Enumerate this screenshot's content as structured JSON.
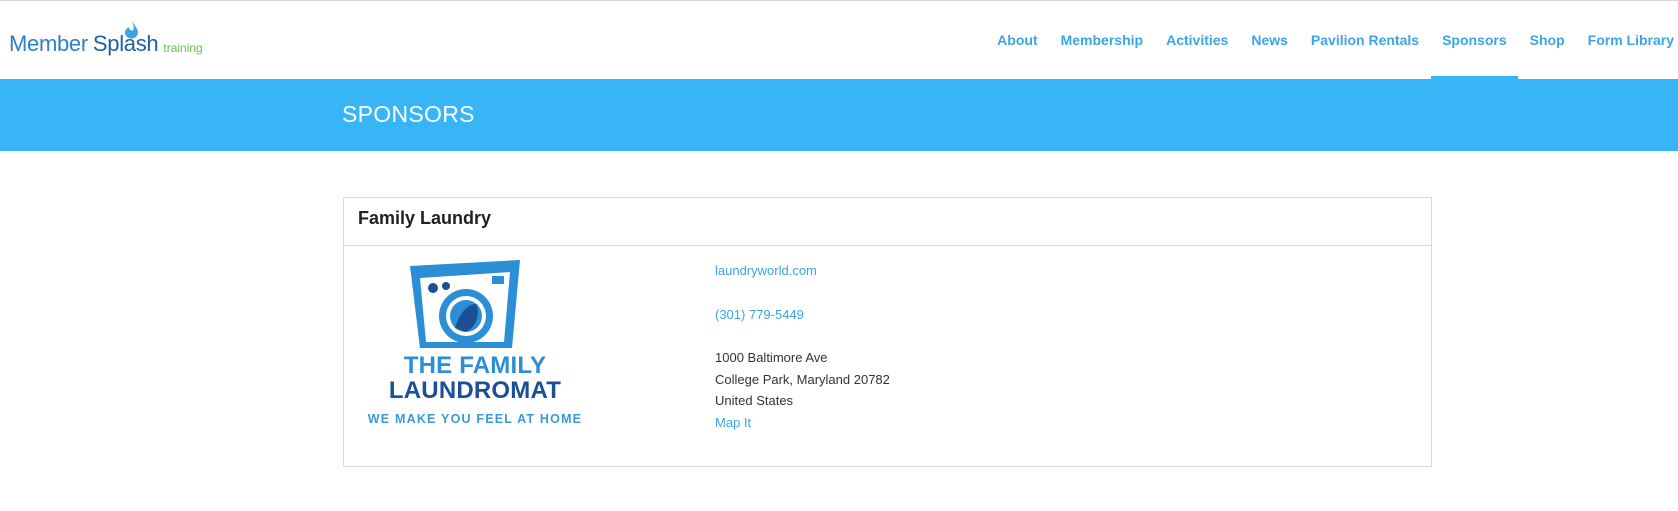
{
  "brand": {
    "member": "Member",
    "splash": "Splash",
    "training": "training",
    "colors": {
      "accent": "#37b5f6",
      "link": "#3aa6e6",
      "logo_green": "#6abf4b"
    }
  },
  "nav": {
    "items": [
      {
        "label": "About"
      },
      {
        "label": "Membership"
      },
      {
        "label": "Activities"
      },
      {
        "label": "News"
      },
      {
        "label": "Pavilion Rentals"
      },
      {
        "label": "Sponsors",
        "active": true
      },
      {
        "label": "Shop"
      },
      {
        "label": "Form Library"
      }
    ]
  },
  "banner": {
    "title": "SPONSORS"
  },
  "sponsor": {
    "name": "Family Laundry",
    "logo": {
      "icon": "washing-machine-icon",
      "line1": "THE FAMILY",
      "line2": "LAUNDROMAT",
      "tagline": "WE MAKE YOU FEEL AT HOME"
    },
    "website": "laundryworld.com",
    "phone": "(301) 779-5449",
    "address": {
      "street": "1000 Baltimore Ave",
      "city_line": "College Park, Maryland 20782",
      "country": "United States"
    },
    "map_link": "Map It"
  }
}
